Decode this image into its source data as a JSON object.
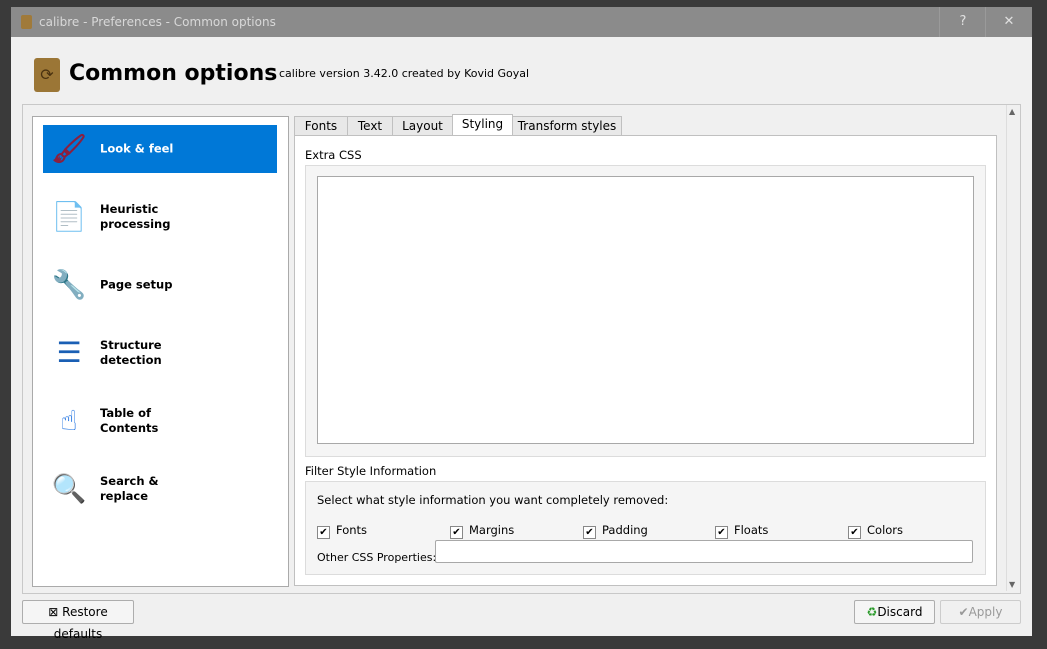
{
  "window": {
    "title": "calibre - Preferences - Common options",
    "help": "?",
    "close": "✕"
  },
  "header": {
    "title": "Common options",
    "subtitle": "calibre version 3.42.0 created by Kovid Goyal"
  },
  "sidebar": {
    "items": [
      {
        "label": "Look & feel",
        "icon": "brush-icon",
        "selected": true
      },
      {
        "label": "Heuristic processing",
        "icon": "document-bandage-icon"
      },
      {
        "label": "Page setup",
        "icon": "tools-icon"
      },
      {
        "label": "Structure detection",
        "icon": "numbered-list-icon"
      },
      {
        "label": "Table of Contents",
        "icon": "toc-hand-icon"
      },
      {
        "label": "Search & replace",
        "icon": "magnifier-icon"
      }
    ]
  },
  "tabs": [
    {
      "label": "Fonts"
    },
    {
      "label": "Text"
    },
    {
      "label": "Layout"
    },
    {
      "label": "Styling",
      "selected": true
    },
    {
      "label": "Transform styles"
    }
  ],
  "styling": {
    "extra_css_label": "Extra CSS",
    "extra_css_value": "",
    "filter_label": "Filter Style Information",
    "filter_prompt": "Select what style information you want completely removed:",
    "checkboxes": [
      {
        "label": "Fonts",
        "checked": true
      },
      {
        "label": "Margins",
        "checked": true
      },
      {
        "label": "Padding",
        "checked": true
      },
      {
        "label": "Floats",
        "checked": true
      },
      {
        "label": "Colors",
        "checked": true
      }
    ],
    "other_css_label": "Other CSS Properties:",
    "other_css_value": ""
  },
  "buttons": {
    "restore": "Restore defaults",
    "discard": "Discard",
    "apply": "Apply"
  },
  "colors": {
    "selection": "#0078d7",
    "titlebar": "#8b8b8b"
  }
}
